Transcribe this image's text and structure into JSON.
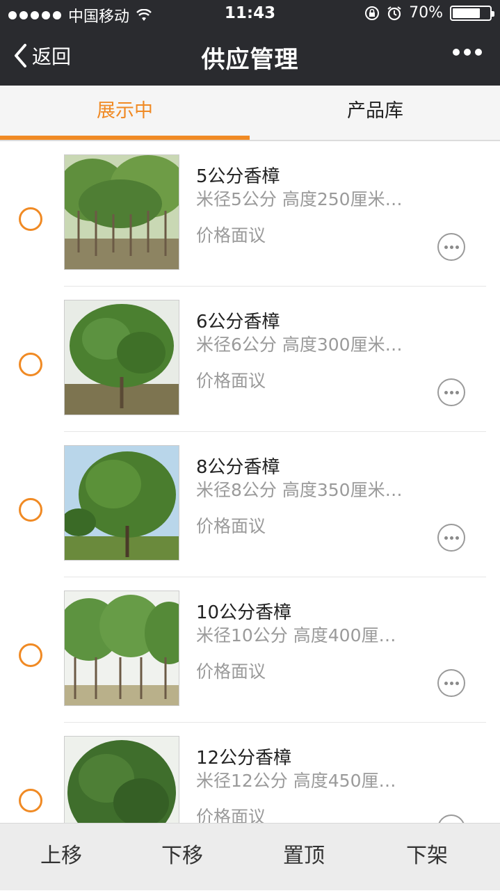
{
  "status_bar": {
    "carrier": "中国移动",
    "time": "11:43",
    "battery": "70%"
  },
  "nav": {
    "back_label": "返回",
    "title": "供应管理"
  },
  "tabs": [
    {
      "label": "展示中",
      "active": true
    },
    {
      "label": "产品库",
      "active": false
    }
  ],
  "items": [
    {
      "name": "5公分香樟",
      "spec": "米径5公分 高度250厘米…",
      "price": "价格面议"
    },
    {
      "name": "6公分香樟",
      "spec": "米径6公分 高度300厘米…",
      "price": "价格面议"
    },
    {
      "name": "8公分香樟",
      "spec": "米径8公分 高度350厘米…",
      "price": "价格面议"
    },
    {
      "name": "10公分香樟",
      "spec": "米径10公分 高度400厘…",
      "price": "价格面议"
    },
    {
      "name": "12公分香樟",
      "spec": "米径12公分 高度450厘…",
      "price": "价格面议"
    }
  ],
  "toolbar": {
    "move_up": "上移",
    "move_down": "下移",
    "pin_top": "置顶",
    "take_down": "下架"
  },
  "colors": {
    "accent": "#f08a24",
    "header_bg": "#2a2b2f"
  }
}
